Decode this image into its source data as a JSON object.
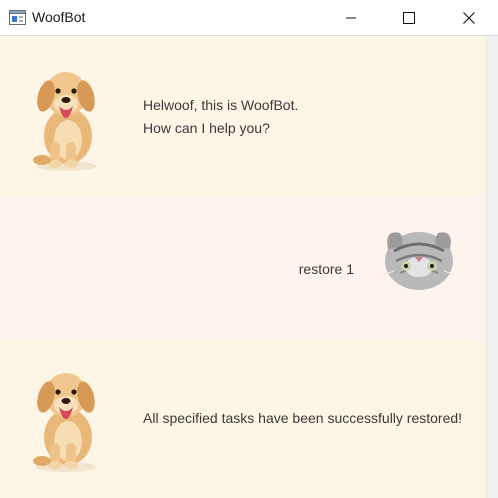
{
  "window": {
    "title": "WoofBot",
    "icons": {
      "app": "window-app-icon",
      "minimize": "minimize-icon",
      "maximize": "maximize-icon",
      "close": "close-icon"
    }
  },
  "chat": {
    "messages": [
      {
        "sender": "bot",
        "avatar": "puppy-avatar",
        "lines": [
          "Helwoof, this is WoofBot.",
          "How can I help you?"
        ]
      },
      {
        "sender": "user",
        "avatar": "cat-avatar",
        "lines": [
          "restore 1"
        ]
      },
      {
        "sender": "bot",
        "avatar": "puppy-avatar",
        "lines": [
          "All specified tasks have been successfully restored!"
        ]
      }
    ]
  },
  "colors": {
    "bot_bg": "#fdf5e6",
    "user_bg": "#fff3ee",
    "text": "#3a3a3a"
  }
}
